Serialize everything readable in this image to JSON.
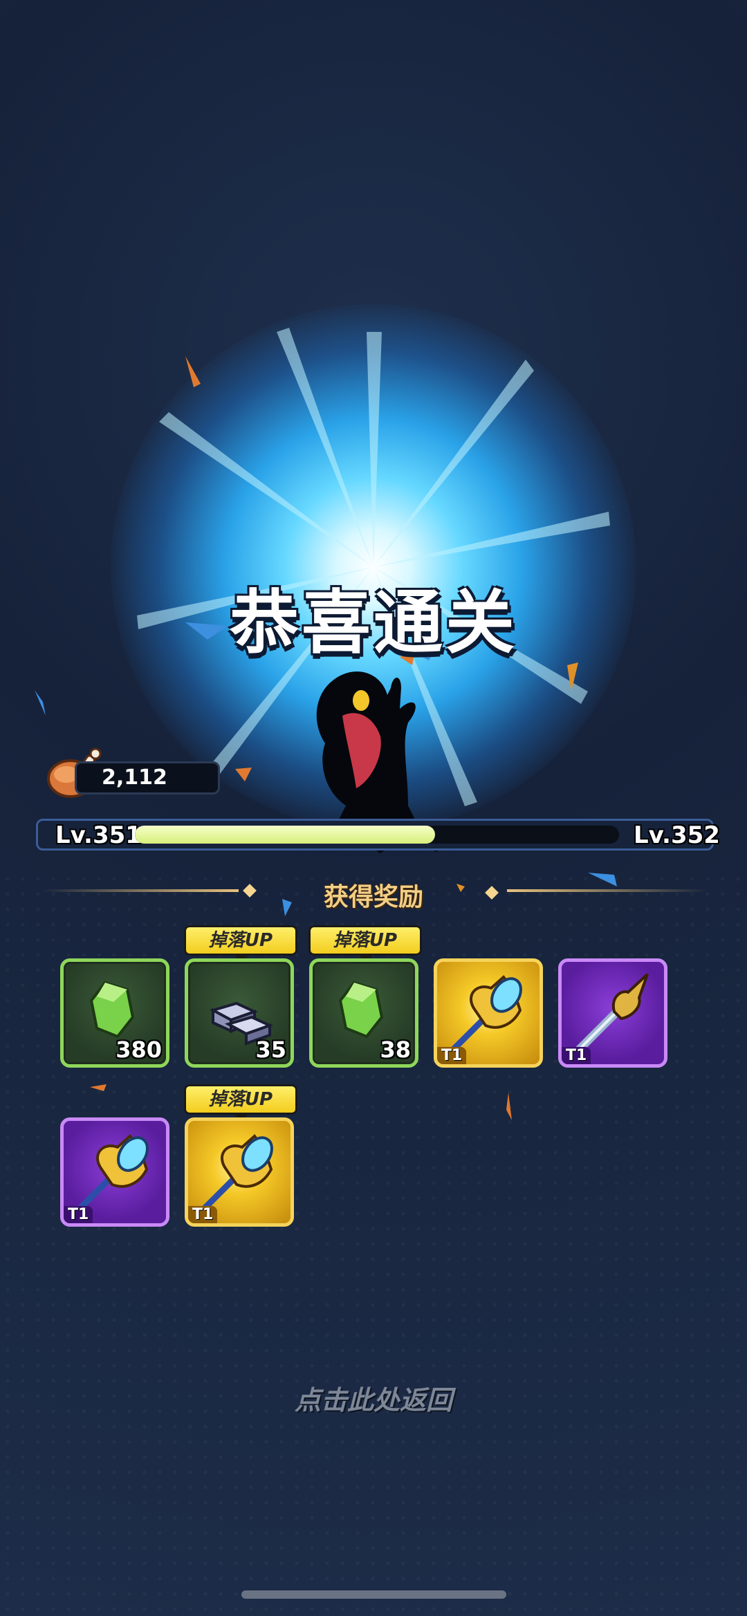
{
  "banner": {
    "title": "恭喜通关"
  },
  "resource": {
    "icon": "meat-icon",
    "amount": "2,112"
  },
  "level": {
    "current": "Lv.351",
    "next": "Lv.352",
    "progress": 0.62
  },
  "rewards": {
    "title": "获得奖励",
    "drop_badge": "掉落UP",
    "items": [
      {
        "icon": "green-gem-icon",
        "rarity": "green",
        "quantity": "380",
        "tier": "",
        "drop_up": false
      },
      {
        "icon": "iron-ingot-icon",
        "rarity": "green",
        "quantity": "35",
        "tier": "",
        "drop_up": true
      },
      {
        "icon": "green-gem-icon",
        "rarity": "green",
        "quantity": "38",
        "tier": "",
        "drop_up": true
      },
      {
        "icon": "crystal-trident-icon",
        "rarity": "gold",
        "quantity": "",
        "tier": "T1",
        "drop_up": false
      },
      {
        "icon": "spear-icon",
        "rarity": "purple",
        "quantity": "",
        "tier": "T1",
        "drop_up": false
      },
      {
        "icon": "crystal-trident-icon",
        "rarity": "purple",
        "quantity": "",
        "tier": "T1",
        "drop_up": false
      },
      {
        "icon": "crystal-trident-icon",
        "rarity": "gold",
        "quantity": "",
        "tier": "T1",
        "drop_up": true
      }
    ]
  },
  "footer": {
    "return_text": "点击此处返回"
  },
  "colors": {
    "accent_gold": "#f2cf86",
    "progress_fill": "#d8ef7a",
    "rarity_green": "#8fd65a",
    "rarity_gold": "#f6d35a",
    "rarity_purple": "#c98af7"
  }
}
